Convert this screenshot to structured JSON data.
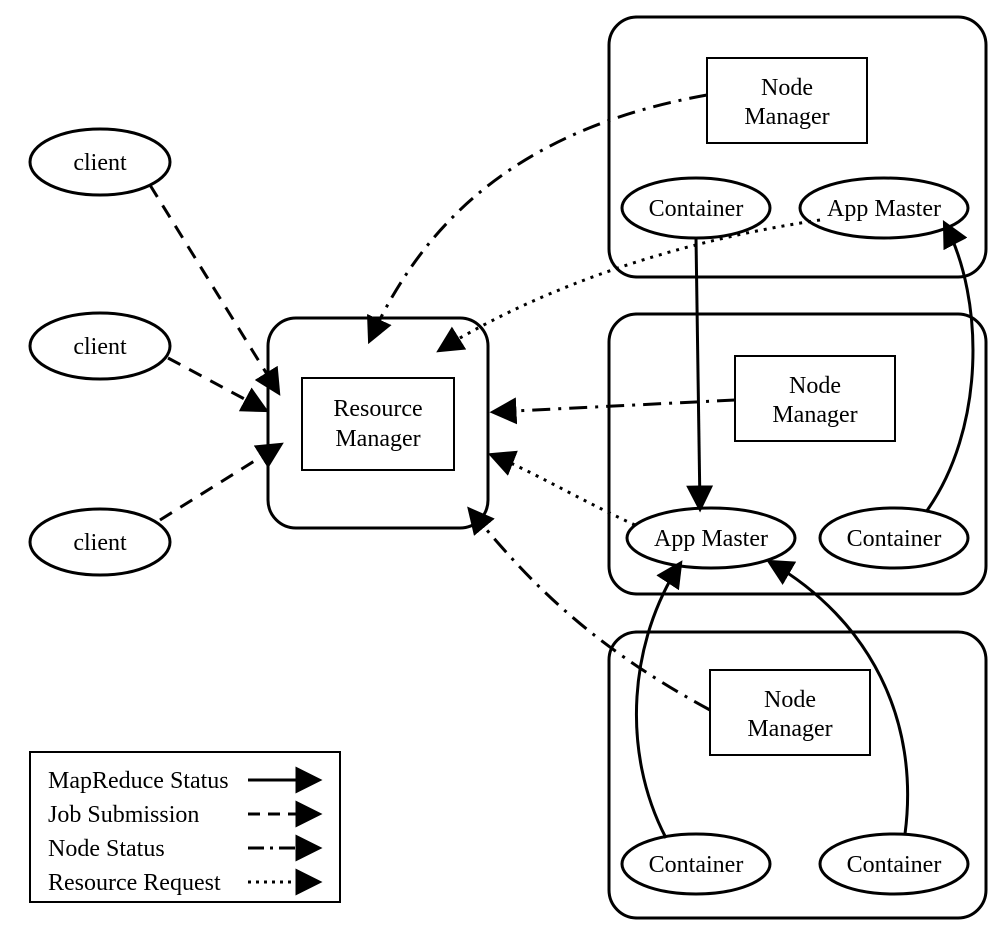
{
  "nodes": {
    "client1": "client",
    "client2": "client",
    "client3": "client",
    "resource_manager": "Resource",
    "resource_manager_line2": "Manager",
    "node_manager": "Node",
    "node_manager_line2": "Manager",
    "container": "Container",
    "app_master": "App Master"
  },
  "legend": {
    "mapreduce_status": "MapReduce Status",
    "job_submission": "Job Submission",
    "node_status": "Node Status",
    "resource_request": "Resource Request"
  }
}
